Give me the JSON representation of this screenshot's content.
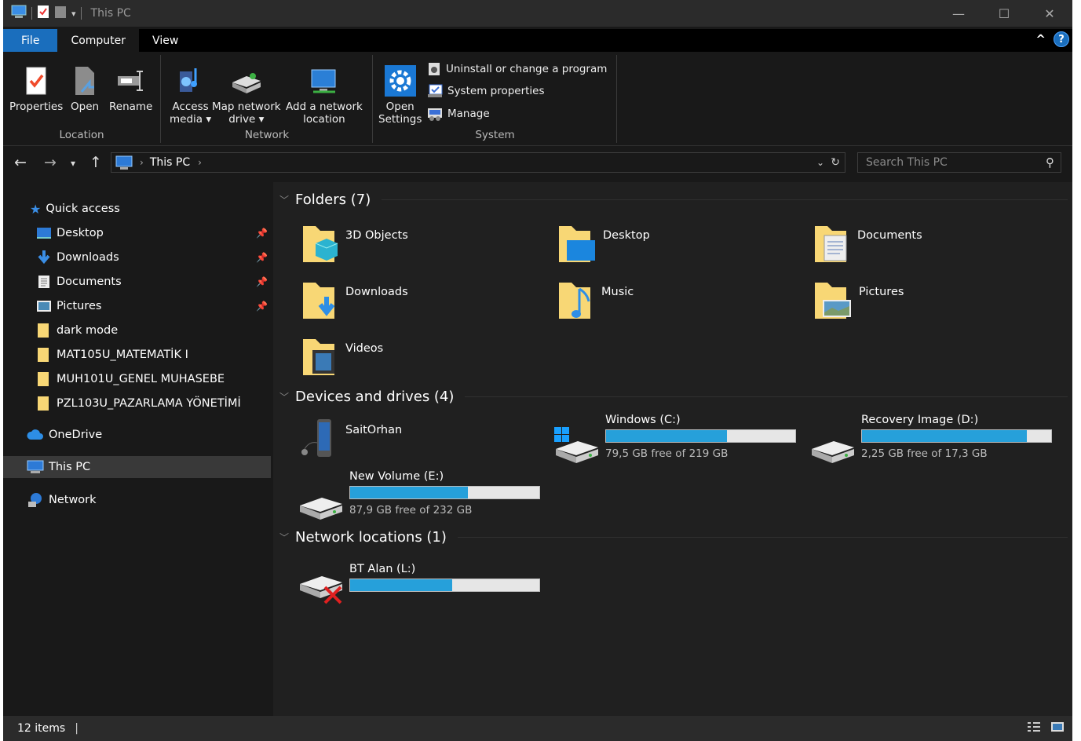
{
  "window": {
    "title": "This PC",
    "minimize": "—",
    "maximize": "☐",
    "close": "✕"
  },
  "tabs": {
    "file": "File",
    "computer": "Computer",
    "view": "View",
    "collapse": "^",
    "help": "?"
  },
  "ribbon": {
    "location": {
      "label": "Location",
      "properties": "Properties",
      "open": "Open",
      "rename": "Rename"
    },
    "network": {
      "label": "Network",
      "access_media_1": "Access",
      "access_media_2": "media ▾",
      "map_drive_1": "Map network",
      "map_drive_2": "drive ▾",
      "add_location_1": "Add a network",
      "add_location_2": "location"
    },
    "system": {
      "label": "System",
      "open_settings_1": "Open",
      "open_settings_2": "Settings",
      "uninstall": "Uninstall or change a program",
      "sys_props": "System properties",
      "manage": "Manage"
    }
  },
  "address": {
    "path": "This PC",
    "search_placeholder": "Search This PC"
  },
  "sidebar": {
    "quick_access": "Quick access",
    "pinned": [
      "Desktop",
      "Downloads",
      "Documents",
      "Pictures"
    ],
    "folders": [
      "dark mode",
      "MAT105U_MATEMATİK I",
      "MUH101U_GENEL MUHASEBE",
      "PZL103U_PAZARLAMA YÖNETİMİ"
    ],
    "onedrive": "OneDrive",
    "this_pc": "This PC",
    "network": "Network"
  },
  "sections": {
    "folders": "Folders (7)",
    "devices": "Devices and drives (4)",
    "network": "Network locations (1)"
  },
  "folders": [
    "3D Objects",
    "Desktop",
    "Documents",
    "Downloads",
    "Music",
    "Pictures",
    "Videos"
  ],
  "devices": {
    "phone": "SaitOrhan",
    "c": {
      "name": "Windows (C:)",
      "free": "79,5 GB free of 219 GB",
      "used_pct": 63.7
    },
    "d": {
      "name": "Recovery Image (D:)",
      "free": "2,25 GB free of 17,3 GB",
      "used_pct": 87
    },
    "e": {
      "name": "New Volume (E:)",
      "free": "87,9 GB free of 232 GB",
      "used_pct": 62.1
    },
    "l": {
      "name": "BT Alan (L:)",
      "used_pct": 54
    }
  },
  "status": {
    "items": "12 items"
  }
}
